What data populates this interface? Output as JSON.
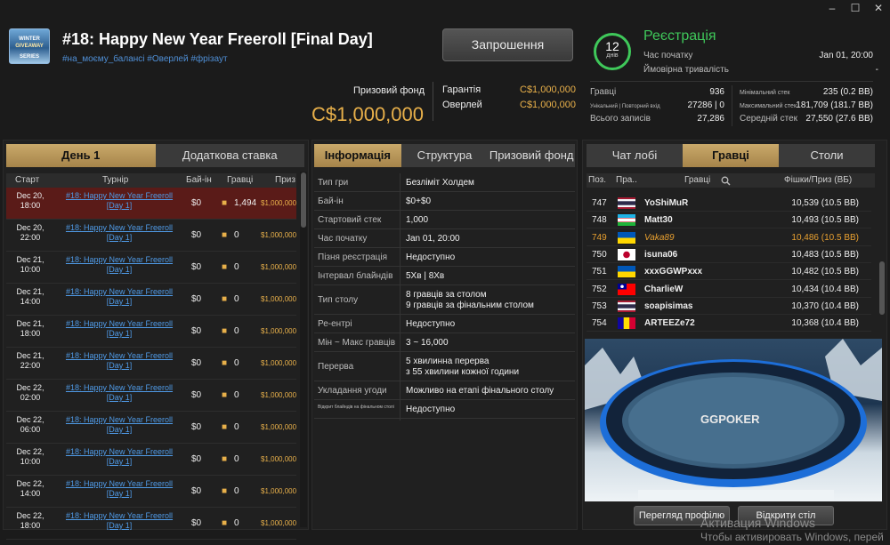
{
  "tournament": {
    "title": "#18: Happy New Year Freeroll [Final Day]",
    "tags": "#на_моєму_балансі #Оверлей #фрізаут",
    "logo_text": [
      "WINTER",
      "GIVEAWAY",
      "SERIES"
    ],
    "invite_label": "Запрошення",
    "prize_fund_label": "Призовий фонд",
    "prize_fund_amount": "C$1,000,000",
    "guarantee_label": "Гарантія",
    "guarantee_value": "C$1,000,000",
    "overlay_label": "Оверлей",
    "overlay_value": "C$1,000,000"
  },
  "status": {
    "days_number": "12",
    "days_label": "днів",
    "state": "Реєстрація",
    "start_label": "Час початку",
    "start_value": "Jan 01, 20:00",
    "duration_label": "Ймовірна тривалість",
    "duration_value": "-",
    "players_label": "Гравці",
    "players_value": "936",
    "unique_label": "Унікальний | Повторний вхід",
    "unique_value": "27286 | 0",
    "total_entries_label": "Всього записів",
    "total_entries_value": "27,286",
    "min_stack_label": "Мінімальний стек",
    "min_stack_value": "235 (0.2 BB)",
    "max_stack_label": "Максимальний стек",
    "max_stack_value": "181,709 (181.7 BB)",
    "avg_stack_label": "Середній стек",
    "avg_stack_value": "27,550 (27.6 BB)"
  },
  "window_controls": {
    "minimize": "–",
    "maximize": "☐",
    "close": "✕"
  },
  "left_panel": {
    "tabs": [
      "День 1",
      "Додаткова ставка"
    ],
    "columns": [
      "Старт",
      "Турнір",
      "Бай-ін",
      "Гравці",
      "Приз"
    ],
    "rows": [
      {
        "date": "Dec 20,",
        "time": "18:00",
        "name": "#18: Happy New Year Freeroll",
        "day": "[Day 1]",
        "buyin": "$0",
        "players": "1,494",
        "prize": "$1,000,000"
      },
      {
        "date": "Dec 20,",
        "time": "22:00",
        "name": "#18: Happy New Year Freeroll",
        "day": "[Day 1]",
        "buyin": "$0",
        "players": "0",
        "prize": "$1,000,000"
      },
      {
        "date": "Dec 21,",
        "time": "10:00",
        "name": "#18: Happy New Year Freeroll",
        "day": "[Day 1]",
        "buyin": "$0",
        "players": "0",
        "prize": "$1,000,000"
      },
      {
        "date": "Dec 21,",
        "time": "14:00",
        "name": "#18: Happy New Year Freeroll",
        "day": "[Day 1]",
        "buyin": "$0",
        "players": "0",
        "prize": "$1,000,000"
      },
      {
        "date": "Dec 21,",
        "time": "18:00",
        "name": "#18: Happy New Year Freeroll",
        "day": "[Day 1]",
        "buyin": "$0",
        "players": "0",
        "prize": "$1,000,000"
      },
      {
        "date": "Dec 21,",
        "time": "22:00",
        "name": "#18: Happy New Year Freeroll",
        "day": "[Day 1]",
        "buyin": "$0",
        "players": "0",
        "prize": "$1,000,000"
      },
      {
        "date": "Dec 22,",
        "time": "02:00",
        "name": "#18: Happy New Year Freeroll",
        "day": "[Day 1]",
        "buyin": "$0",
        "players": "0",
        "prize": "$1,000,000"
      },
      {
        "date": "Dec 22,",
        "time": "06:00",
        "name": "#18: Happy New Year Freeroll",
        "day": "[Day 1]",
        "buyin": "$0",
        "players": "0",
        "prize": "$1,000,000"
      },
      {
        "date": "Dec 22,",
        "time": "10:00",
        "name": "#18: Happy New Year Freeroll",
        "day": "[Day 1]",
        "buyin": "$0",
        "players": "0",
        "prize": "$1,000,000"
      },
      {
        "date": "Dec 22,",
        "time": "14:00",
        "name": "#18: Happy New Year Freeroll",
        "day": "[Day 1]",
        "buyin": "$0",
        "players": "0",
        "prize": "$1,000,000"
      },
      {
        "date": "Dec 22,",
        "time": "18:00",
        "name": "#18: Happy New Year Freeroll",
        "day": "[Day 1]",
        "buyin": "$0",
        "players": "0",
        "prize": "$1,000,000"
      }
    ]
  },
  "middle_panel": {
    "tabs": [
      "Інформація",
      "Структура",
      "Призовий фонд"
    ],
    "info": [
      {
        "k": "Тип гри",
        "v": "Безліміт Холдем"
      },
      {
        "k": "Бай-ін",
        "v": "$0+$0"
      },
      {
        "k": "Стартовий стек",
        "v": "1,000"
      },
      {
        "k": "Час початку",
        "v": "Jan 01, 20:00"
      },
      {
        "k": "Пізня реєстрація",
        "v": "Недоступно"
      },
      {
        "k": "Інтервал блайндів",
        "v": "5Хв | 8Хв"
      },
      {
        "k": "Тип столу",
        "v": "8 гравців за столом",
        "v2": "9 гравців за фінальним столом"
      },
      {
        "k": "Ре-ентрі",
        "v": "Недоступно"
      },
      {
        "k": "Мін ~ Макс гравців",
        "v": "3 ~ 16,000"
      },
      {
        "k": "Перерва",
        "v": "5 хвилинна перерва",
        "v2": "з 55 хвилини кожної години"
      },
      {
        "k": "Укладання угоди",
        "v": "Можливо на етапі фінального столу"
      },
      {
        "k": "Відкрит блайндів на фінальном столі",
        "v": "Недоступно"
      }
    ]
  },
  "right_panel": {
    "tabs": [
      "Чат лобі",
      "Гравці",
      "Столи"
    ],
    "columns": [
      "Поз.",
      "Пра..",
      "Гравці",
      "Фішки/Приз (ВБ)"
    ],
    "players": [
      {
        "pos": "747",
        "flag": "thailand",
        "name": "YoShiMuR",
        "chips": "10,539 (10.5 BB)"
      },
      {
        "pos": "748",
        "flag": "uzbekistan",
        "name": "Matt30",
        "chips": "10,493 (10.5 BB)"
      },
      {
        "pos": "749",
        "flag": "ukraine",
        "name": "Vaka89",
        "chips": "10,486 (10.5 BB)"
      },
      {
        "pos": "750",
        "flag": "japan",
        "name": "isuna06",
        "chips": "10,483 (10.5 BB)"
      },
      {
        "pos": "751",
        "flag": "ukraine",
        "name": "xxxGGWPxxx",
        "chips": "10,482 (10.5 BB)"
      },
      {
        "pos": "752",
        "flag": "taiwan",
        "name": "CharlieW",
        "chips": "10,434 (10.4 BB)"
      },
      {
        "pos": "753",
        "flag": "thailand",
        "name": "soapisimas",
        "chips": "10,370 (10.4 BB)"
      },
      {
        "pos": "754",
        "flag": "andorra",
        "name": "ARTEEZe72",
        "chips": "10,368 (10.4 BB)"
      }
    ],
    "table_brand": "GGPOKER",
    "view_profile": "Перегляд профілю",
    "open_table": "Відкрити стіл"
  },
  "watermark": {
    "line1": "Активация Windows",
    "line2": "Чтобы активировать Windows, перей"
  },
  "colors": {
    "accent_gold": "#e8b04a",
    "green": "#3fc85a",
    "link_blue": "#4f9ae6",
    "selected_row": "#5a1b18"
  }
}
